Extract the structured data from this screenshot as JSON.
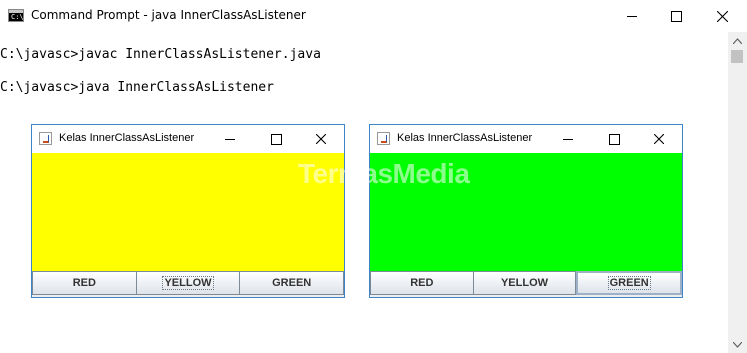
{
  "console_window": {
    "title": "Command Prompt - java  InnerClassAsListener",
    "icon_text": "C:\\.",
    "lines": [
      "C:\\javasc>javac InnerClassAsListener.java",
      "C:\\javasc>java InnerClassAsListener"
    ],
    "icons": {
      "minimize": "minimize-icon",
      "maximize": "maximize-icon",
      "close": "close-icon"
    }
  },
  "watermark": "TermasMedia",
  "frames": [
    {
      "title": "Kelas InnerClassAsListener",
      "panel_color": "#ffff00",
      "buttons": [
        "RED",
        "YELLOW",
        "GREEN"
      ],
      "focused_button": "YELLOW"
    },
    {
      "title": "Kelas InnerClassAsListener",
      "panel_color": "#00ff00",
      "buttons": [
        "RED",
        "YELLOW",
        "GREEN"
      ],
      "focused_button": "GREEN"
    }
  ],
  "colors": {
    "frame_border": "#3d85c6",
    "yellow": "#ffff00",
    "green": "#00ff00"
  }
}
